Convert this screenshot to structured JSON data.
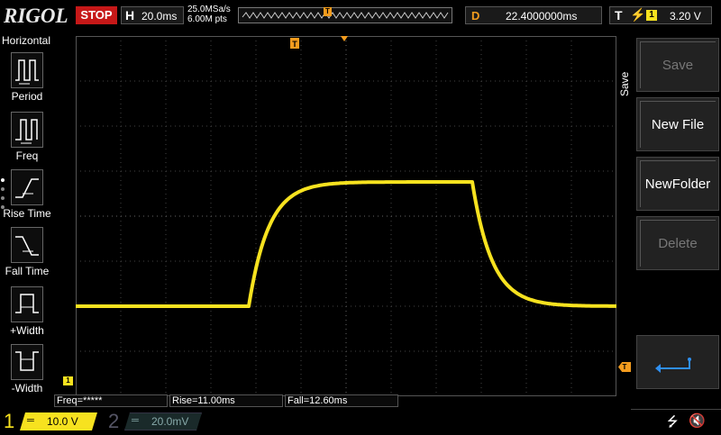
{
  "header": {
    "brand": "RIGOL",
    "run_state": "STOP",
    "timebase_label": "H",
    "timebase_value": "20.0ms",
    "sample_rate": "25.0MSa/s",
    "memory_depth": "6.00M pts",
    "delay_label": "D",
    "delay_value": "22.4000000ms",
    "trigger_label": "T",
    "trigger_channel": "1",
    "trigger_level": "3.20 V"
  },
  "left_menu": {
    "title": "Horizontal",
    "items": [
      {
        "label": "Period",
        "icon": "period-icon"
      },
      {
        "label": "Freq",
        "icon": "freq-icon"
      },
      {
        "label": "Rise Time",
        "icon": "rise-time-icon"
      },
      {
        "label": "Fall Time",
        "icon": "fall-time-icon"
      },
      {
        "label": "+Width",
        "icon": "positive-width-icon"
      },
      {
        "label": "-Width",
        "icon": "negative-width-icon"
      }
    ]
  },
  "right_menu": {
    "title": "Save",
    "buttons": [
      {
        "label": "Save",
        "enabled": false
      },
      {
        "label": "New File",
        "enabled": true
      },
      {
        "label": "NewFolder",
        "enabled": true
      },
      {
        "label": "Delete",
        "enabled": false
      }
    ],
    "return_icon": "return-arrow-icon"
  },
  "markers": {
    "trigger_marker": "T",
    "channel_ground_marker": "1"
  },
  "measurements": [
    {
      "text": "Freq=*****"
    },
    {
      "text": "Rise=11.00ms"
    },
    {
      "text": "Fall=12.60ms"
    }
  ],
  "channels": [
    {
      "number": "1",
      "scale": "10.0 V",
      "active": true
    },
    {
      "number": "2",
      "scale": "20.0mV",
      "active": false
    }
  ],
  "colors": {
    "ch1": "#f7e21f",
    "trigger": "#f39c1e",
    "stop": "#c61818",
    "return_icon": "#2f8ff0"
  }
}
